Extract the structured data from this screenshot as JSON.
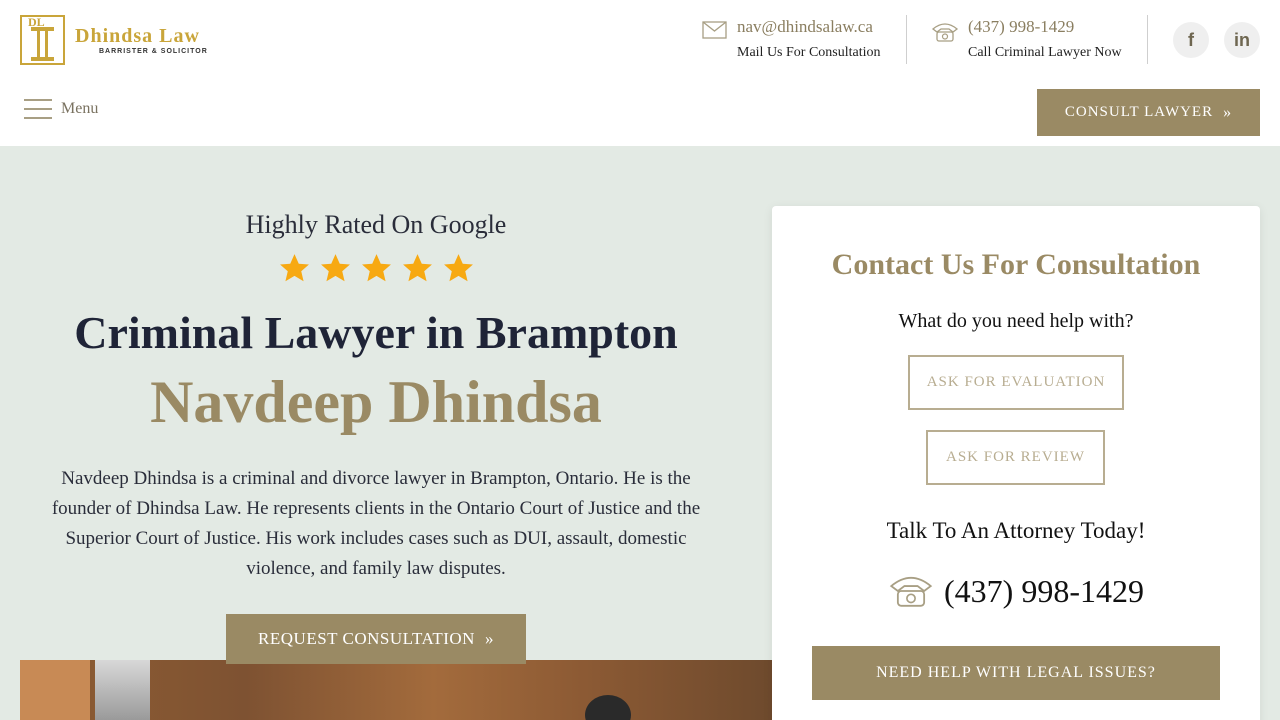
{
  "brand": {
    "initials": "DL",
    "name": "Dhindsa Law",
    "tagline": "BARRISTER & SOLICITOR",
    "accent": "#9a8a64",
    "gold": "#c9a53a"
  },
  "header": {
    "email": {
      "value": "nav@dhindsalaw.ca",
      "label": "Mail Us For Consultation",
      "icon": "envelope-icon"
    },
    "phone": {
      "value": "(437) 998-1429",
      "label": "Call Criminal Lawyer Now",
      "icon": "phone-icon"
    },
    "social": [
      {
        "name": "facebook",
        "glyph": "f"
      },
      {
        "name": "linkedin",
        "glyph": "in"
      }
    ],
    "menu_label": "Menu",
    "consult_label": "CONSULT LAWYER"
  },
  "hero": {
    "rated": "Highly Rated On Google",
    "stars": 5,
    "title": "Criminal Lawyer in Brampton",
    "name": "Navdeep Dhindsa",
    "description": "Navdeep Dhindsa is a criminal and divorce lawyer in Brampton, Ontario. He is the founder of Dhindsa Law. He represents clients in the Ontario Court of Justice and the Superior Court of Justice. His work includes cases such as DUI, assault, domestic violence, and family law disputes.",
    "cta_label": "REQUEST CONSULTATION"
  },
  "form": {
    "title": "Contact Us For Consultation",
    "question": "What do you need help with?",
    "options": [
      "ASK FOR EVALUATION",
      "ASK FOR REVIEW"
    ],
    "talk": "Talk To An Attorney Today!",
    "phone": "(437) 998-1429",
    "help_label": "NEED HELP WITH LEGAL ISSUES?"
  }
}
